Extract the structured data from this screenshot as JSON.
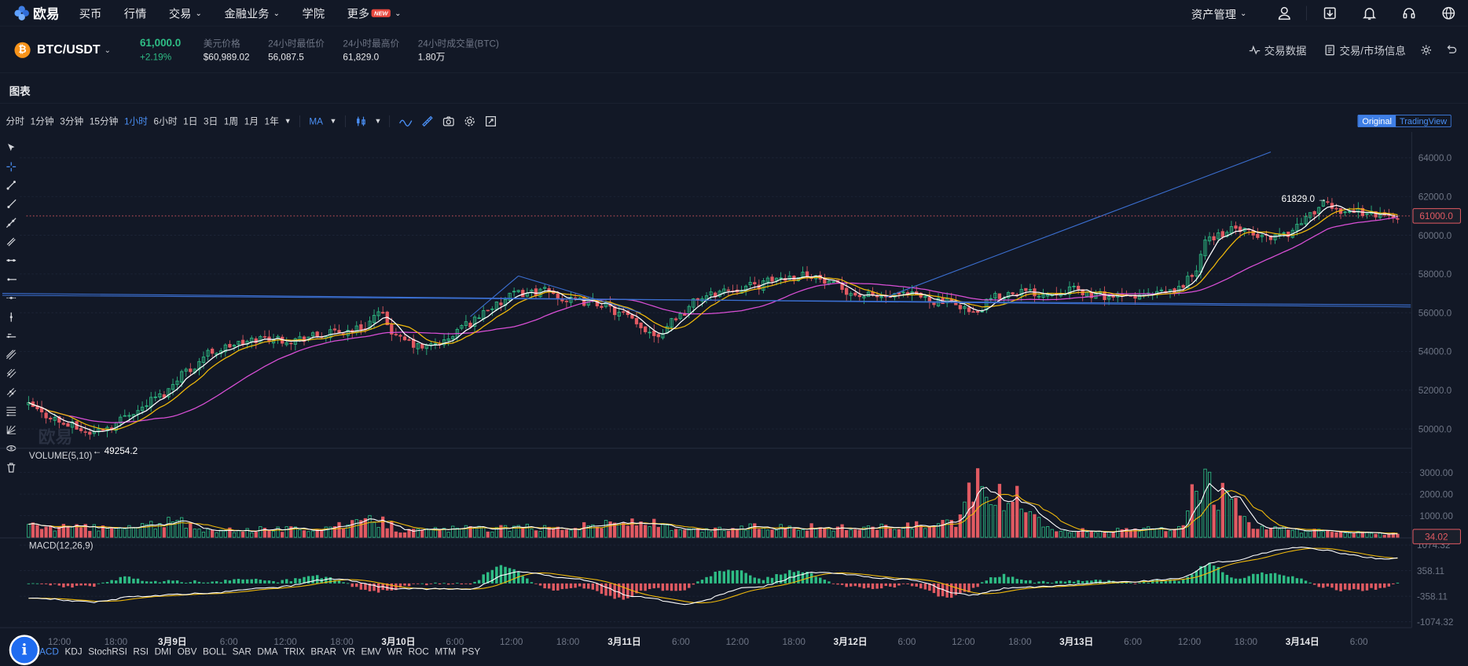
{
  "brand": {
    "logo_text": "欧易"
  },
  "nav": {
    "items": [
      "买币",
      "行情",
      "交易",
      "金融业务",
      "学院",
      "更多"
    ],
    "new_badge": "NEW",
    "asset_mgmt": "资产管理"
  },
  "ticker": {
    "pair": "BTC/USDT",
    "coin_symbol": "₿",
    "last": "61,000.0",
    "change": "+2.19%",
    "stats": [
      {
        "label": "美元价格",
        "value": "$60,989.02"
      },
      {
        "label": "24小时最低价",
        "value": "56,087.5"
      },
      {
        "label": "24小时最高价",
        "value": "61,829.0"
      },
      {
        "label": "24小时成交量(BTC)",
        "value": "1.80万"
      }
    ],
    "right": [
      "交易数据",
      "交易/市场信息"
    ]
  },
  "chart_section": {
    "title": "图表"
  },
  "toolbar": {
    "intervals": [
      "分时",
      "1分钟",
      "3分钟",
      "15分钟",
      "1小时",
      "6小时",
      "1日",
      "3日",
      "1周",
      "1月",
      "1年"
    ],
    "active_interval": "1小时",
    "indicator": "MA",
    "view_original": "Original",
    "view_tradingview": "TradingView"
  },
  "indicators": [
    "MACD",
    "KDJ",
    "StochRSI",
    "RSI",
    "DMI",
    "OBV",
    "BOLL",
    "SAR",
    "DMA",
    "TRIX",
    "BRAR",
    "VR",
    "EMV",
    "WR",
    "ROC",
    "MTM",
    "PSY"
  ],
  "active_indicator": "MACD",
  "colors": {
    "up": "#2ebd85",
    "down": "#e15a62",
    "ma1": "#ffffff",
    "ma2": "#f0b90b",
    "ma3": "#d94fd6",
    "trend": "#3b6fd1",
    "accent": "#4a8ff4",
    "bg": "#121826"
  },
  "chart_data": {
    "type": "candlestick",
    "price_axis": {
      "ticks": [
        "64000.0",
        "62000.0",
        "60000.0",
        "58000.0",
        "56000.0",
        "54000.0",
        "52000.0",
        "50000.0"
      ],
      "ylim": [
        49000,
        65000
      ]
    },
    "price_ticks": [
      64000,
      62000,
      60000,
      58000,
      56000,
      54000,
      52000,
      50000
    ],
    "last_price_label": "61000.0",
    "last_price": 61000,
    "high_label": "61829.0",
    "high": 61829,
    "low_label": "49254.2",
    "low": 49254.2,
    "volume_title": "VOLUME(5,10)",
    "volume_axis": {
      "ticks": [
        "3000.00",
        "2000.00",
        "1000.00"
      ]
    },
    "volume_ticks": [
      3000,
      2000,
      1000
    ],
    "volume_ylim": [
      0,
      4000
    ],
    "volume_last_label": "34.02",
    "macd_title": "MACD(12,26,9)",
    "macd_axis": {
      "ticks": [
        "1074.32",
        "358.11",
        "-358.11",
        "-1074.32"
      ]
    },
    "macd_ticks": [
      1074.32,
      358.11,
      -358.11,
      -1074.32
    ],
    "macd_ylim": [
      -1200,
      1200
    ],
    "x_labels": [
      "12:00",
      "18:00",
      "3月9日",
      "6:00",
      "12:00",
      "18:00",
      "3月10日",
      "6:00",
      "12:00",
      "18:00",
      "3月11日",
      "6:00",
      "12:00",
      "18:00",
      "3月12日",
      "6:00",
      "12:00",
      "18:00",
      "3月13日",
      "6:00",
      "12:00",
      "18:00",
      "3月14日",
      "6:00"
    ],
    "x_label_bold": [
      "3月9日",
      "3月10日",
      "3月11日",
      "3月12日",
      "3月13日",
      "3月14日"
    ],
    "price_keypoints": [
      [
        0,
        51200
      ],
      [
        4,
        50700
      ],
      [
        9,
        50200
      ],
      [
        14,
        49800
      ],
      [
        18,
        50100
      ],
      [
        24,
        50900
      ],
      [
        30,
        51700
      ],
      [
        36,
        53000
      ],
      [
        42,
        54000
      ],
      [
        48,
        54400
      ],
      [
        54,
        54700
      ],
      [
        60,
        54600
      ],
      [
        66,
        54800
      ],
      [
        71,
        55000
      ],
      [
        76,
        55200
      ],
      [
        80,
        55900
      ],
      [
        85,
        54600
      ],
      [
        90,
        54200
      ],
      [
        95,
        54500
      ],
      [
        100,
        55400
      ],
      [
        106,
        56300
      ],
      [
        112,
        57000
      ],
      [
        118,
        57100
      ],
      [
        124,
        56600
      ],
      [
        130,
        56500
      ],
      [
        136,
        55900
      ],
      [
        140,
        55200
      ],
      [
        144,
        54900
      ],
      [
        148,
        55800
      ],
      [
        154,
        56800
      ],
      [
        160,
        57200
      ],
      [
        166,
        57400
      ],
      [
        172,
        57800
      ],
      [
        178,
        58000
      ],
      [
        184,
        57400
      ],
      [
        190,
        56900
      ],
      [
        196,
        56800
      ],
      [
        202,
        56900
      ],
      [
        208,
        56600
      ],
      [
        213,
        56400
      ],
      [
        216,
        55900
      ],
      [
        221,
        56800
      ],
      [
        226,
        57100
      ],
      [
        232,
        57000
      ],
      [
        238,
        57200
      ],
      [
        244,
        56900
      ],
      [
        250,
        56800
      ],
      [
        256,
        56900
      ],
      [
        262,
        57100
      ],
      [
        266,
        57900
      ],
      [
        270,
        59900
      ],
      [
        276,
        60300
      ],
      [
        282,
        59900
      ],
      [
        288,
        60100
      ],
      [
        292,
        60900
      ],
      [
        296,
        61600
      ],
      [
        300,
        61300
      ],
      [
        305,
        61200
      ],
      [
        310,
        61000
      ]
    ],
    "volume_keypoints": [
      [
        0,
        500
      ],
      [
        20,
        420
      ],
      [
        34,
        700
      ],
      [
        40,
        300
      ],
      [
        60,
        380
      ],
      [
        70,
        500
      ],
      [
        80,
        750
      ],
      [
        86,
        300
      ],
      [
        100,
        400
      ],
      [
        120,
        450
      ],
      [
        140,
        700
      ],
      [
        150,
        300
      ],
      [
        170,
        500
      ],
      [
        190,
        420
      ],
      [
        212,
        580
      ],
      [
        216,
        2600
      ],
      [
        222,
        1800
      ],
      [
        228,
        1700
      ],
      [
        234,
        300
      ],
      [
        250,
        300
      ],
      [
        262,
        400
      ],
      [
        268,
        2300
      ],
      [
        274,
        1800
      ],
      [
        280,
        400
      ],
      [
        300,
        250
      ],
      [
        310,
        150
      ]
    ],
    "macd_keypoints": [
      [
        0,
        -400
      ],
      [
        15,
        -520
      ],
      [
        25,
        -360
      ],
      [
        40,
        -280
      ],
      [
        55,
        -120
      ],
      [
        70,
        120
      ],
      [
        85,
        -150
      ],
      [
        100,
        -160
      ],
      [
        112,
        330
      ],
      [
        125,
        120
      ],
      [
        140,
        -380
      ],
      [
        150,
        -580
      ],
      [
        165,
        -120
      ],
      [
        180,
        300
      ],
      [
        200,
        120
      ],
      [
        215,
        -320
      ],
      [
        225,
        -120
      ],
      [
        250,
        40
      ],
      [
        262,
        120
      ],
      [
        272,
        600
      ],
      [
        290,
        1000
      ],
      [
        310,
        700
      ]
    ],
    "trendlines_price": [
      {
        "from": [
          -6,
          56900
        ],
        "to": [
          316,
          56400
        ]
      },
      {
        "from": [
          -6,
          57000
        ],
        "to": [
          316,
          56300
        ]
      },
      {
        "from": [
          196,
          56800
        ],
        "to": [
          284,
          64300
        ]
      },
      {
        "from": [
          101,
          55800
        ],
        "to": [
          112,
          57900
        ]
      },
      {
        "from": [
          112,
          57900
        ],
        "to": [
          140,
          56000
        ]
      }
    ]
  }
}
